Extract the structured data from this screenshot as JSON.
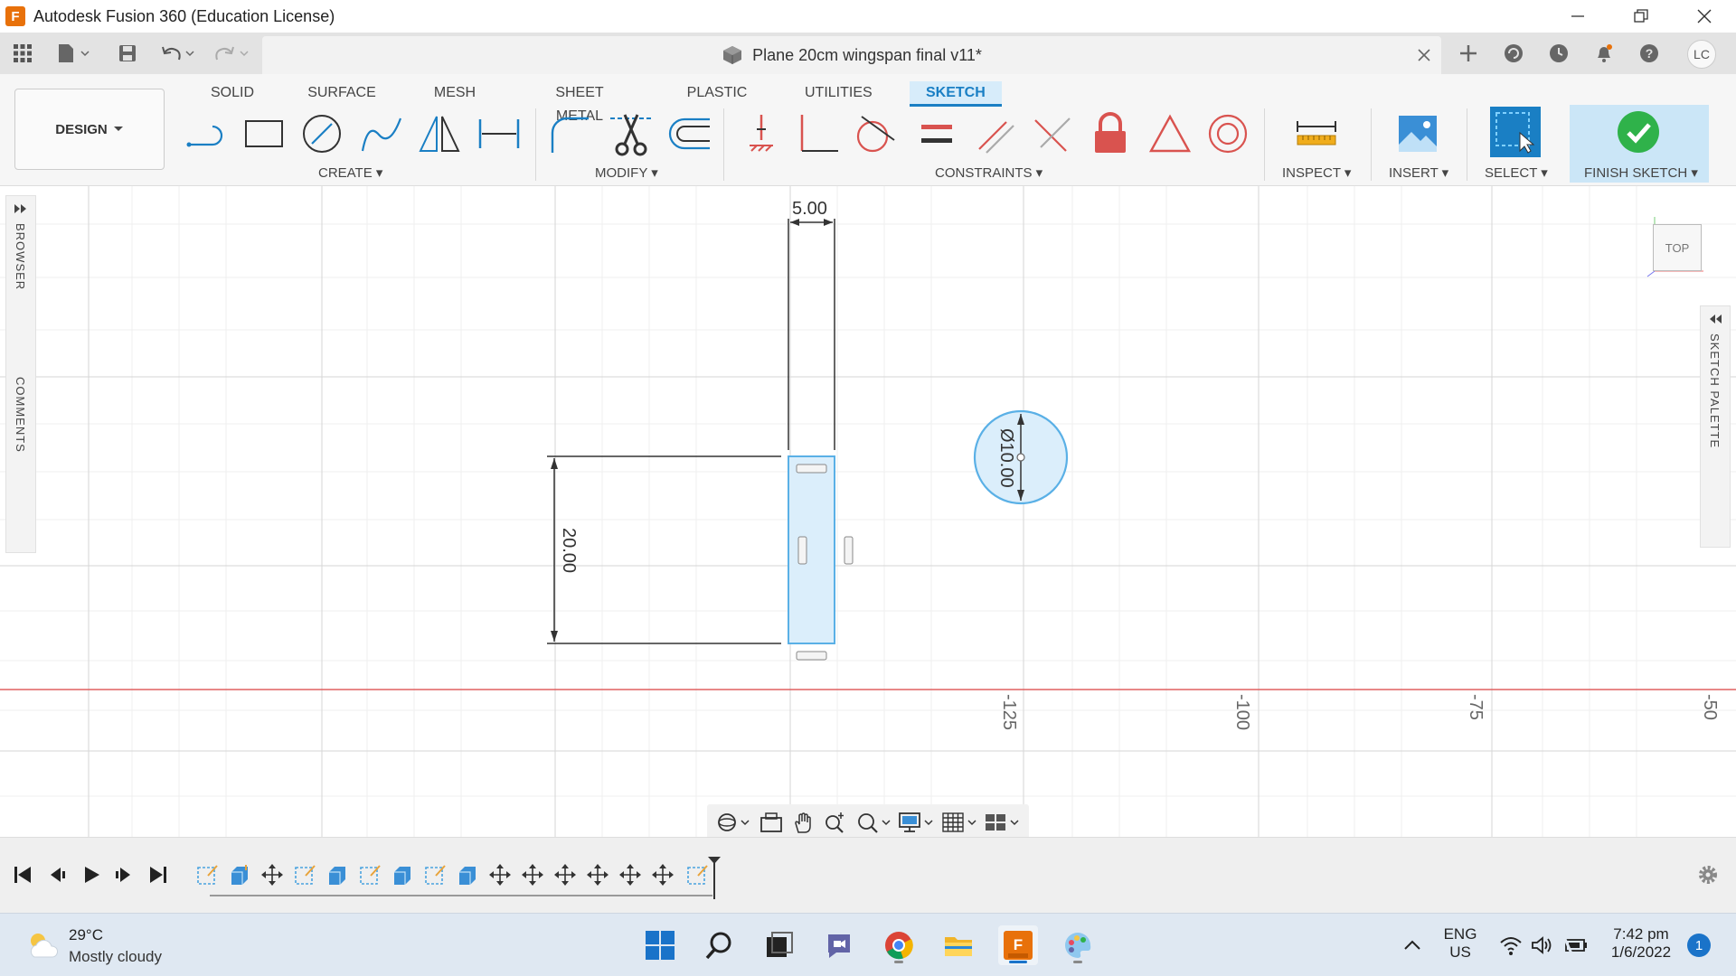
{
  "window": {
    "title": "Autodesk Fusion 360 (Education License)",
    "logo_letter": "F",
    "document_title": "Plane 20cm wingspan final v11*",
    "user_initials": "LC"
  },
  "ribbon": {
    "workspace": "DESIGN",
    "tabs": [
      {
        "label": "SOLID"
      },
      {
        "label": "SURFACE"
      },
      {
        "label": "MESH"
      },
      {
        "label": "SHEET METAL"
      },
      {
        "label": "PLASTIC"
      },
      {
        "label": "UTILITIES"
      },
      {
        "label": "SKETCH"
      }
    ],
    "groups": {
      "create": "CREATE",
      "modify": "MODIFY",
      "constraints": "CONSTRAINTS",
      "inspect": "INSPECT",
      "insert": "INSERT",
      "select": "SELECT",
      "finish": "FINISH SKETCH"
    }
  },
  "panels": {
    "browser": "BROWSER",
    "comments": "COMMENTS",
    "sketch_palette": "SKETCH PALETTE"
  },
  "sketch": {
    "dim_width": "5.00",
    "dim_height": "20.00",
    "dim_diameter": "Ø10.00",
    "axis_labels": [
      "-125",
      "-100",
      "-75",
      "-50"
    ],
    "viewcube_face": "TOP"
  },
  "colors": {
    "accent": "#1a7fc4",
    "finish_green": "#2fb24a",
    "sketch_fill": "#dbeefb",
    "red_axis": "#e06060",
    "lock_red": "#d9534f"
  },
  "taskbar": {
    "temperature": "29°C",
    "weather": "Mostly cloudy",
    "lang_top": "ENG",
    "lang_bottom": "US",
    "time": "7:42 pm",
    "date": "1/6/2022",
    "notification_count": "1"
  }
}
